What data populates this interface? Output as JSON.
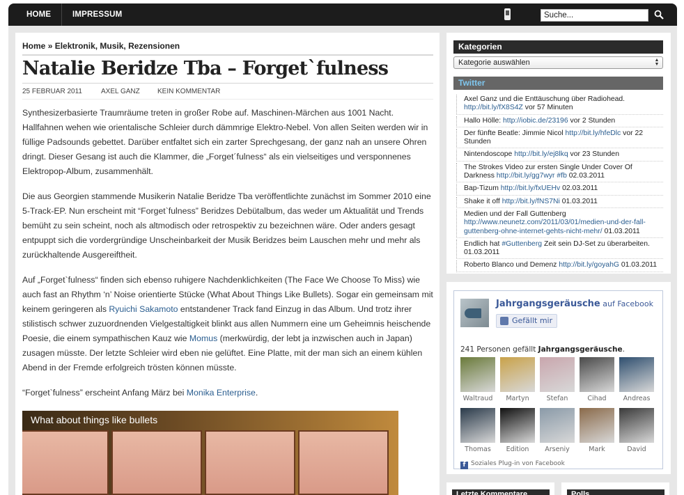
{
  "nav": {
    "home": "HOME",
    "impressum": "IMPRESSUM"
  },
  "search": {
    "placeholder": "Suche...",
    "value": "Suche..."
  },
  "breadcrumb": {
    "home": "Home",
    "separator": "»",
    "categories": "Elektronik, Musik, Rezensionen"
  },
  "post": {
    "title": "Natalie Beridze Tba – Forget`fulness",
    "date": "25 FEBRUAR 2011",
    "author": "AXEL GANZ",
    "comments": "KEIN KOMMENTAR",
    "p1": "Synthesizerbasierte Traumräume treten in großer Robe auf. Maschinen-Märchen aus 1001 Nacht. Hallfahnen wehen wie orientalische Schleier durch dämmrige Elektro-Nebel. Von allen Seiten werden wir in füllige Padsounds gebettet. Darüber entfaltet sich ein zarter Sprechgesang, der ganz nah an unsere Ohren dringt. Dieser Gesang ist auch die Klammer, die „Forget´fulness“ als ein vielseitiges und versponnenes Elektropop-Album, zusammenhält.",
    "p2": "Die aus Georgien stammende Musikerin Natalie Beridze Tba veröffentlichte zunächst im Sommer 2010 eine 5-Track-EP. Nun erscheint mit “Forget`fulness” Beridzes Debütalbum, das weder um Aktualität und Trends bemüht zu sein scheint, noch als altmodisch oder retrospektiv zu bezeichnen wäre. Oder anders gesagt entpuppt sich die vordergründige Unscheinbarkeit der Musik Beridzes beim Lauschen mehr und mehr als zurückhaltende Ausgereiftheit.",
    "p3_a": "Auf „Forget`fulness“ finden sich ebenso ruhigere Nachdenklichkeiten (The Face We Choose To Miss) wie auch fast an Rhythm ‘n’ Noise orientierte Stücke (What About Things Like Bullets). Sogar ein gemeinsam mit keinem geringeren als ",
    "p3_link1": "Ryuichi Sakamoto",
    "p3_b": " entstandener Track fand Einzug in das Album. Und trotz ihrer stilistisch schwer zuzuordnenden Vielgestaltigkeit blinkt aus allen Nummern eine um Geheimnis heischende Poesie, die einem sympathischen Kauz wie ",
    "p3_link2": "Momus",
    "p3_c": " (merkwürdig, der lebt ja inzwischen auch in Japan) zusagen müsste. Der letzte Schleier wird eben nie gelüftet. Eine Platte, mit der man sich an einem kühlen Abend in der Fremde erfolgreich trösten können müsste.",
    "p4_a": "“Forget`fulness” erscheint Anfang März bei ",
    "p4_link": "Monika Enterprise",
    "p4_b": ".",
    "video_title": "What about things like bullets"
  },
  "sidebar": {
    "categories_heading": "Kategorien",
    "categories_select": "Kategorie auswählen",
    "twitter_heading": "Twitter",
    "tweets": [
      {
        "text": "Axel Ganz und die Enttäuschung über Radiohead. ",
        "link": "http://bit.ly/fX8S4Z",
        "ago": " vor 57 Minuten"
      },
      {
        "text": "Hallo Hölle: ",
        "link": "http://iobic.de/23196",
        "ago": " vor 2 Stunden"
      },
      {
        "text": "Der fünfte Beatle: Jimmie Nicol ",
        "link": "http://bit.ly/hfeDlc",
        "ago": " vor 22 Stunden"
      },
      {
        "text": "Nintendoscope ",
        "link": "http://bit.ly/ej8lkq",
        "ago": " vor 23 Stunden"
      },
      {
        "text": "The Strokes Video zur ersten Single Under Cover Of Darkness ",
        "link": "http://bit.ly/gg7wyr #fb",
        "ago": " 02.03.2011"
      },
      {
        "text": "Bap-Tizum ",
        "link": "http://bit.ly/fxUEHv",
        "ago": " 02.03.2011"
      },
      {
        "text": "Shake it off ",
        "link": "http://bit.ly/fNS7Ni",
        "ago": " 01.03.2011"
      },
      {
        "text": "Medien und der Fall Guttenberg ",
        "link": "http://www.neunetz.com/2011/03/01/medien-und-der-fall-guttenberg-ohne-internet-gehts-nicht-mehr/",
        "ago": " 01.03.2011"
      },
      {
        "text": "Endlich hat ",
        "link": "#Guttenberg",
        "ago": " Zeit sein DJ-Set zu überarbeiten. 01.03.2011"
      },
      {
        "text": "Roberto Blanco und Demenz ",
        "link": "http://bit.ly/goyahG",
        "ago": " 01.03.2011"
      }
    ]
  },
  "facebook": {
    "page_name": "Jahrgangsgeräusche",
    "on_facebook": " auf Facebook",
    "like_button": "Gefällt mir",
    "count_text": "241 Personen gefällt ",
    "count_page": "Jahrgangsgeräusche",
    "count_end": ".",
    "faces": [
      {
        "name": "Waltraud",
        "color": "#6a7a3a"
      },
      {
        "name": "Martyn",
        "color": "#c9a24a"
      },
      {
        "name": "Stefan",
        "color": "#c9a6ad"
      },
      {
        "name": "Cihad",
        "color": "#4a4a4a"
      },
      {
        "name": "Andreas",
        "color": "#2f4f6f"
      },
      {
        "name": "Thomas",
        "color": "#2a3a4a"
      },
      {
        "name": "Edition",
        "color": "#111111"
      },
      {
        "name": "Arseniy",
        "color": "#8a9aa8"
      },
      {
        "name": "Mark",
        "color": "#8a6a4a"
      },
      {
        "name": "David",
        "color": "#3a3a3a"
      }
    ],
    "footer": "Soziales Plug-in von Facebook"
  },
  "bottom": {
    "left_heading": "Letzte Kommentare",
    "right_heading": "Polls"
  },
  "colors": {
    "link": "#2a5d8f",
    "facebook": "#3b5998",
    "topbar": "#1c1c1c"
  }
}
